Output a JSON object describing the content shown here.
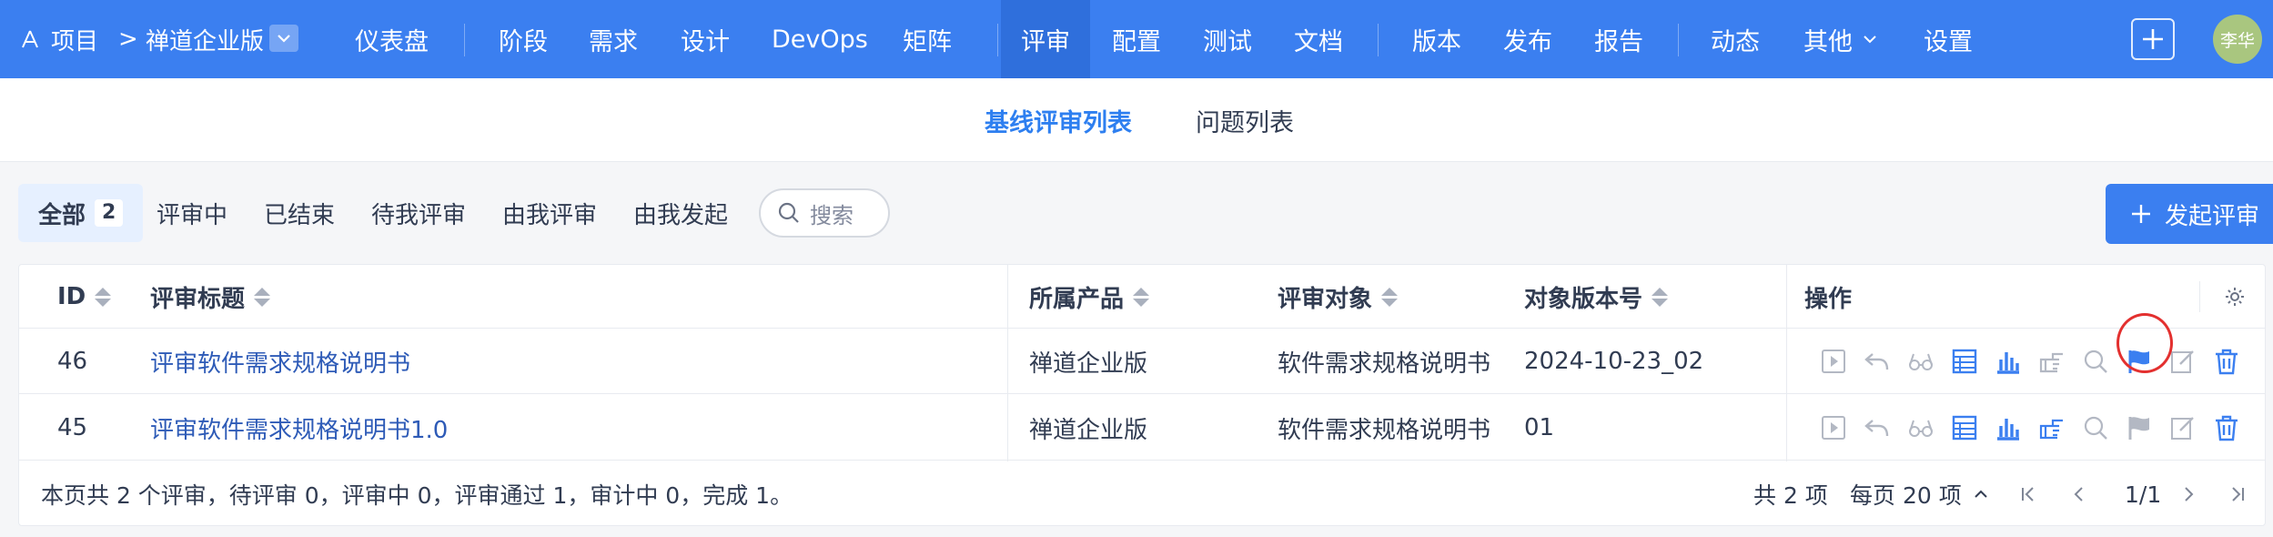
{
  "topbar": {
    "breadcrumb_root": "项目",
    "breadcrumb_sep": ">",
    "product": "禅道企业版",
    "nav": [
      "仪表盘",
      "阶段",
      "需求",
      "设计",
      "DevOps",
      "矩阵",
      "评审",
      "配置",
      "测试",
      "文档",
      "版本",
      "发布",
      "报告",
      "动态",
      "其他",
      "设置"
    ],
    "active_nav": "评审",
    "avatar": "李华"
  },
  "subnav": {
    "items": [
      "基线评审列表",
      "问题列表"
    ],
    "active": "基线评审列表"
  },
  "filters": {
    "tabs": [
      "全部",
      "评审中",
      "已结束",
      "待我评审",
      "由我评审",
      "由我发起"
    ],
    "all_count": "2",
    "search_placeholder": "搜索",
    "launch_button": "发起评审"
  },
  "table": {
    "columns": [
      "ID",
      "评审标题",
      "所属产品",
      "评审对象",
      "对象版本号",
      "操作"
    ],
    "rows": [
      {
        "id": "46",
        "title": "评审软件需求规格说明书",
        "product": "禅道企业版",
        "object": "软件需求规格说明书",
        "version": "2024-10-23_02"
      },
      {
        "id": "45",
        "title": "评审软件需求规格说明书1.0",
        "product": "禅道企业版",
        "object": "软件需求规格说明书",
        "version": "01"
      }
    ],
    "row_actions": [
      "play-icon",
      "undo-icon",
      "glasses-icon",
      "report-table-icon",
      "bar-chart-icon",
      "hand-point-icon",
      "search-icon",
      "flag-icon",
      "edit-icon",
      "trash-icon"
    ]
  },
  "footer": {
    "summary": "本页共 2 个评审，待评审 0，评审中 0，评审通过 1，审计中 0，完成 1。",
    "total": "共 2 项",
    "per_page": "每页 20 项",
    "page": "1/1"
  },
  "colors": {
    "primary": "#3b7ff0",
    "link": "#2e5bb7",
    "highlight_circle": "#e3302f"
  }
}
